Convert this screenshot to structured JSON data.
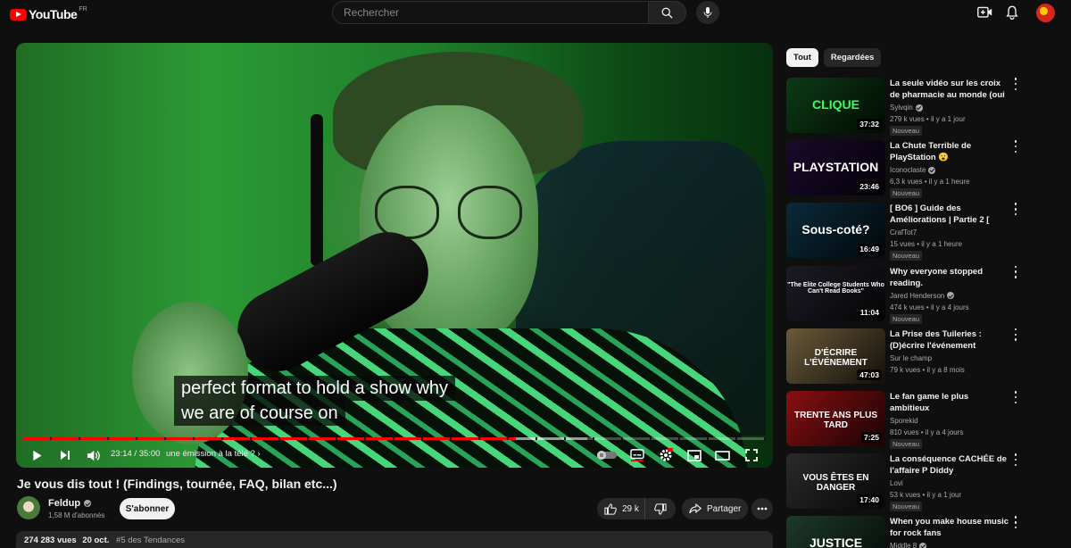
{
  "header": {
    "logo_text": "YouTube",
    "country_code": "FR",
    "search_placeholder": "Rechercher"
  },
  "player": {
    "captions": [
      "perfect format to hold a show why",
      "we are of course on"
    ],
    "time_display": "23:14 / 35:00",
    "chapter_title": "une émission à la télé ?",
    "progress_played": 0.664,
    "progress_loaded": 0.76
  },
  "video": {
    "title": "Je vous dis tout ! (Findings, tournée, FAQ, bilan etc...)",
    "channel_name": "Feldup",
    "subscribers": "1,58 M d'abonnés",
    "subscribe_label": "S'abonner",
    "likes": "29 k",
    "share_label": "Partager",
    "views": "274 283 vues",
    "date": "20 oct.",
    "trending_tag": "#5 des Tendances"
  },
  "sidebar": {
    "chips": [
      "Tout",
      "Regardées"
    ],
    "recommendations": [
      {
        "title": "La seule vidéo sur les croix de pharmacie au monde (oui j'en ...",
        "channel": "Sylvqin",
        "verified": true,
        "meta": "279 k vues • il y a 1 jour",
        "badge": "Nouveau",
        "duration": "37:32",
        "thumb_text": "CLIQUE",
        "thumb_color": "#0c3b15"
      },
      {
        "title": "La Chute Terrible de PlayStation 😮",
        "channel": "Iconoclaste",
        "verified": true,
        "meta": "6,3 k vues • il y a 1 heure",
        "badge": "Nouveau",
        "duration": "23:46",
        "thumb_text": "PLAYSTATION",
        "thumb_color": "#1a0a2c"
      },
      {
        "title": "[ BO6 ] Guide des Améliorations | Partie 2 [ Black Ops 6:...",
        "channel": "CrafTot7",
        "verified": false,
        "meta": "15 vues • il y a 1 heure",
        "badge": "Nouveau",
        "duration": "16:49",
        "thumb_text": "Sous-coté?",
        "thumb_color": "#0a2a3a"
      },
      {
        "title": "Why everyone stopped reading.",
        "channel": "Jared Henderson",
        "verified": true,
        "meta": "474 k vues • il y a 4 jours",
        "badge": "Nouveau",
        "duration": "11:04",
        "thumb_text": "\"The Elite College Students Who Can't Read Books\"",
        "thumb_color": "#1b1b24"
      },
      {
        "title": "La Prise des Tuileries : (D)écrire l'événement",
        "channel": "Sur le champ",
        "verified": false,
        "meta": "79 k vues • il y a 8 mois",
        "badge": "",
        "duration": "47:03",
        "thumb_text": "D'ÉCRIRE L'ÉVÉNEMENT",
        "thumb_color": "#6b5a3a"
      },
      {
        "title": "Le fan game le plus ambitieux",
        "channel": "Sporekid",
        "verified": false,
        "meta": "810 vues • il y a 4 jours",
        "badge": "Nouveau",
        "duration": "7:25",
        "thumb_text": "TRENTE ANS PLUS TARD",
        "thumb_color": "#8a0f12"
      },
      {
        "title": "La conséquence CACHÉE de l'affaire P Diddy",
        "channel": "Lovi",
        "verified": false,
        "meta": "53 k vues • il y a 1 jour",
        "badge": "Nouveau",
        "duration": "17:40",
        "thumb_text": "VOUS ÊTES EN DANGER",
        "thumb_color": "#2a2a2a"
      },
      {
        "title": "When you make house music for rock fans",
        "channel": "Middle 8",
        "verified": true,
        "meta": "",
        "badge": "",
        "duration": "",
        "thumb_text": "JUSTICE",
        "thumb_color": "#1d3a2a"
      }
    ]
  },
  "colors": {
    "background": "#0f0f0f",
    "accent": "#ff0000",
    "chip_bg": "#272727"
  }
}
